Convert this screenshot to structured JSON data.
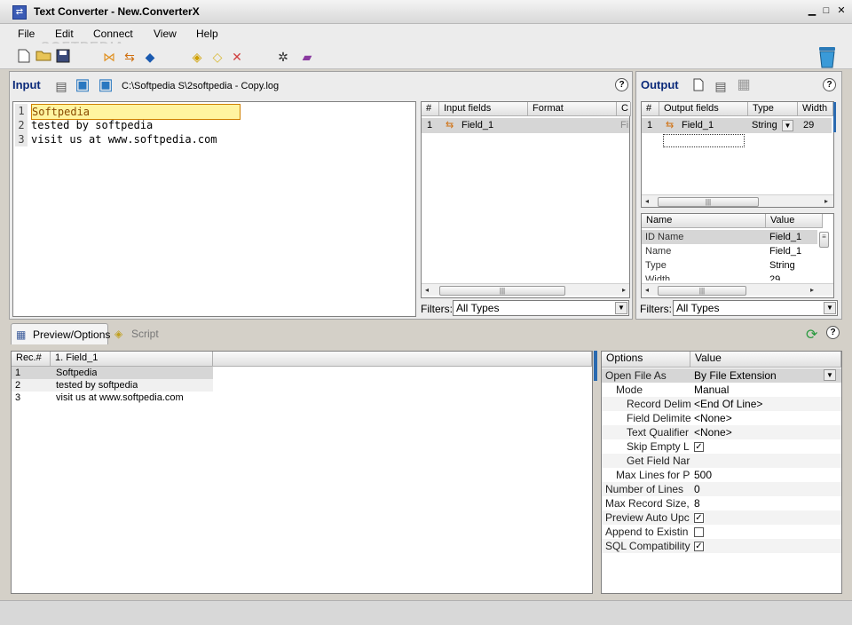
{
  "window": {
    "title": "Text Converter - New.ConverterX",
    "min": "▁",
    "max": "□",
    "close": "✕"
  },
  "menu": [
    "File",
    "Edit",
    "Connect",
    "View",
    "Help"
  ],
  "watermark": "SOFTPEDIA",
  "toolbar_icons": [
    "new-file-icon",
    "open-folder-icon",
    "save-icon",
    "connect-icon",
    "transfer-icon",
    "convert-icon",
    "tag-add-icon",
    "tag-icon",
    "delete-icon",
    "tools-icon",
    "book-icon",
    "trash-icon"
  ],
  "input": {
    "label": "Input",
    "path": "C:\\Softpedia S\\2softpedia - Copy.log",
    "lines": [
      {
        "n": "1",
        "text": "Softpedia"
      },
      {
        "n": "2",
        "text": "tested by softpedia"
      },
      {
        "n": "3",
        "text": "visit us at www.softpedia.com"
      }
    ],
    "fields_header": [
      "#",
      "Input fields",
      "Format",
      "C"
    ],
    "fields": [
      {
        "n": "1",
        "name": "Field_1",
        "format": "",
        "c": "Fi"
      }
    ],
    "filters_label": "Filters:",
    "filter_value": "All Types"
  },
  "output": {
    "label": "Output",
    "fields_header": [
      "#",
      "Output fields",
      "Type",
      "Width"
    ],
    "fields": [
      {
        "n": "1",
        "name": "Field_1",
        "type": "String",
        "width": "29"
      }
    ],
    "props_header": [
      "Name",
      "Value"
    ],
    "props": [
      {
        "name": "ID Name",
        "value": "Field_1"
      },
      {
        "name": "Name",
        "value": "Field_1"
      },
      {
        "name": "Type",
        "value": "String"
      },
      {
        "name": "Width",
        "value": "29"
      }
    ],
    "filters_label": "Filters:",
    "filter_value": "All Types"
  },
  "tabs": [
    {
      "label": "Preview/Options"
    },
    {
      "label": "Script"
    }
  ],
  "preview": {
    "header": [
      "Rec.#",
      "1. Field_1"
    ],
    "rows": [
      {
        "n": "1",
        "v": "Softpedia"
      },
      {
        "n": "2",
        "v": "tested by softpedia"
      },
      {
        "n": "3",
        "v": "visit us at www.softpedia.com"
      }
    ]
  },
  "options": {
    "header": [
      "Options",
      "Value"
    ],
    "rows": [
      {
        "name": "Open File As",
        "value": "By File Extension",
        "indent": 0,
        "type": "combo"
      },
      {
        "name": "Mode",
        "value": "Manual",
        "indent": 1,
        "type": "text"
      },
      {
        "name": "Record Delim",
        "value": "<End Of Line>",
        "indent": 2,
        "type": "text"
      },
      {
        "name": "Field Delimite",
        "value": "<None>",
        "indent": 2,
        "type": "text"
      },
      {
        "name": "Text Qualifier",
        "value": "<None>",
        "indent": 2,
        "type": "text"
      },
      {
        "name": "Skip Empty L",
        "value": "✓",
        "indent": 2,
        "type": "check"
      },
      {
        "name": "Get Field Nar",
        "value": "",
        "indent": 2,
        "type": "text"
      },
      {
        "name": "Max Lines for P",
        "value": "500",
        "indent": 1,
        "type": "text"
      },
      {
        "name": "Number of Lines",
        "value": "0",
        "indent": 0,
        "type": "text"
      },
      {
        "name": "Max Record Size,",
        "value": "8",
        "indent": 0,
        "type": "text"
      },
      {
        "name": "Preview Auto Upc",
        "value": "✓",
        "indent": 0,
        "type": "check"
      },
      {
        "name": "Append to Existin",
        "value": "",
        "indent": 0,
        "type": "check"
      },
      {
        "name": "SQL Compatibility",
        "value": "✓",
        "indent": 0,
        "type": "check"
      }
    ]
  },
  "help": "?"
}
